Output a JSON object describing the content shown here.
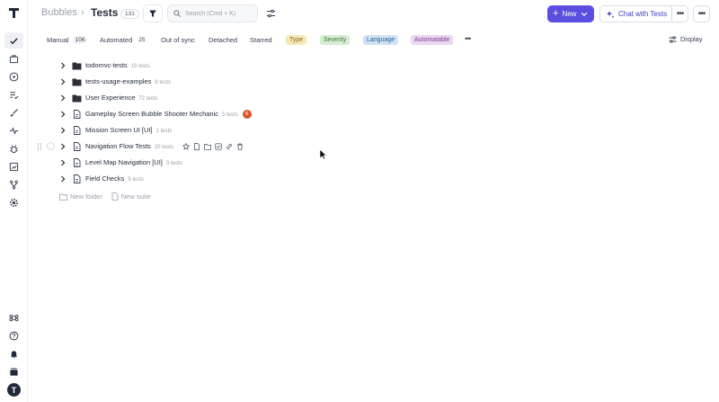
{
  "app": {
    "logo_letter": "T",
    "user_initial": "T"
  },
  "breadcrumb": {
    "parent": "Bubbles",
    "separator": "›",
    "title": "Tests",
    "count": "131"
  },
  "search": {
    "placeholder": "Search (Cmd + K)",
    "value": ""
  },
  "actions": {
    "new_label": "New",
    "chat_label": "Chat with Tests"
  },
  "filters": {
    "tabs": [
      {
        "label": "Manual",
        "count": "106"
      },
      {
        "label": "Automated",
        "count": "25"
      },
      {
        "label": "Out of sync"
      },
      {
        "label": "Detached"
      },
      {
        "label": "Starred"
      }
    ],
    "tags": [
      {
        "label": "Type",
        "bg": "#f6e9b8",
        "fg": "#8a6d1a"
      },
      {
        "label": "Severity",
        "bg": "#d7ecd4",
        "fg": "#3d7a35"
      },
      {
        "label": "Language",
        "bg": "#cfe3f5",
        "fg": "#2d5f8e"
      },
      {
        "label": "Automatable",
        "bg": "#ead7f2",
        "fg": "#7a3e94"
      }
    ],
    "display_label": "Display"
  },
  "tree": {
    "rows": [
      {
        "name": "todomvc-tests",
        "count": "19 tests",
        "kind": "folder"
      },
      {
        "name": "tests-usage-examples",
        "count": "8 tests",
        "kind": "folder"
      },
      {
        "name": "User Experience",
        "count": "72 tests",
        "kind": "folder"
      },
      {
        "name": "Gameplay Screen Bubble Shooter Mechanic",
        "count": "5 tests",
        "kind": "suite",
        "badge": "6"
      },
      {
        "name": "Mission Screen UI [UI]",
        "count": "1 tests",
        "kind": "suite"
      },
      {
        "name": "Navigation Flow Tests",
        "count": "20 tests",
        "kind": "suite",
        "hovered": true
      },
      {
        "name": "Level Map Navigation [UI]",
        "count": "3 tests",
        "kind": "suite"
      },
      {
        "name": "Field Checks",
        "count": "5 tests",
        "kind": "suite"
      }
    ],
    "new_folder_label": "New folder",
    "new_suite_label": "New suite"
  },
  "colors": {
    "accent": "#5a4fe0",
    "badge": "#e0522a"
  }
}
